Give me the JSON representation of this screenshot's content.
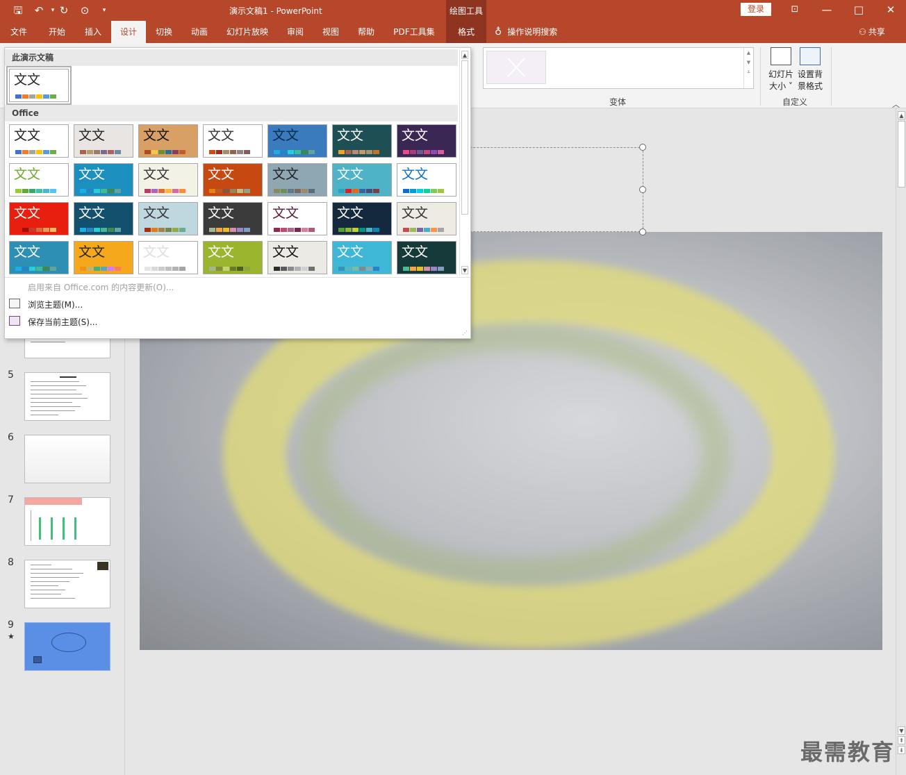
{
  "window": {
    "title": "演示文稿1  -  PowerPoint",
    "context_tab_group": "绘图工具",
    "login": "登录",
    "min": "—",
    "max": "□",
    "close": "✕"
  },
  "tabs": [
    {
      "label": "文件"
    },
    {
      "label": "开始"
    },
    {
      "label": "插入"
    },
    {
      "label": "设计"
    },
    {
      "label": "切换"
    },
    {
      "label": "动画"
    },
    {
      "label": "幻灯片放映"
    },
    {
      "label": "审阅"
    },
    {
      "label": "视图"
    },
    {
      "label": "帮助"
    },
    {
      "label": "PDF工具集"
    },
    {
      "label": "格式"
    }
  ],
  "search_label": "操作说明搜索",
  "share_label": "共享",
  "ribbon": {
    "variants_label": "变体",
    "customize_label": "自定义",
    "slide_size_line1": "幻灯片",
    "slide_size_line2": "大小 ˅",
    "format_bg_line1": "设置背",
    "format_bg_line2": "景格式"
  },
  "theme_gallery": {
    "this_presentation_label": "此演示文稿",
    "office_label": "Office",
    "thumb_text": "文文",
    "current_theme": {
      "swatches": [
        "#4472c4",
        "#ed7d31",
        "#a5a5a5",
        "#ffc000",
        "#5b9bd5",
        "#70ad47"
      ]
    },
    "themes": [
      {
        "bg": "#ffffff",
        "fg": "#222222",
        "sw": [
          "#4472c4",
          "#ed7d31",
          "#a5a5a5",
          "#ffc000",
          "#5b9bd5",
          "#70ad47"
        ]
      },
      {
        "bg": "#e9e5e3",
        "fg": "#222222",
        "sw": [
          "#a5644e",
          "#b39b6b",
          "#9e7b6b",
          "#7c6a8c",
          "#a86464",
          "#6b8c9e"
        ]
      },
      {
        "bg": "#d9a066",
        "fg": "#111111",
        "sw": [
          "#a94c1f",
          "#f3c54a",
          "#6a8e3c",
          "#2f6f8f",
          "#8b3a62",
          "#c35c2b"
        ]
      },
      {
        "bg": "#ffffff",
        "fg": "#333333",
        "sw": [
          "#d34817",
          "#9b2d1f",
          "#a28e6a",
          "#956251",
          "#918485",
          "#855d5d"
        ]
      },
      {
        "bg": "#3a7bbd",
        "fg": "#0a2a4a",
        "sw": [
          "#1cade4",
          "#2683c6",
          "#27ced7",
          "#42ba97",
          "#3e8853",
          "#62a39f"
        ]
      },
      {
        "bg": "#1e4f54",
        "fg": "#ffffff",
        "sw": [
          "#f0a22e",
          "#a5644e",
          "#b58b80",
          "#c3986d",
          "#a19574",
          "#c17529"
        ]
      },
      {
        "bg": "#3b2754",
        "fg": "#ffffff",
        "sw": [
          "#e84c8b",
          "#a63e7c",
          "#6b5b95",
          "#c34a7d",
          "#8a4fb3",
          "#d65ea0"
        ]
      },
      {
        "bg": "#ffffff",
        "fg": "#6da92c",
        "sw": [
          "#99cb38",
          "#63a537",
          "#37a76f",
          "#44c1a3",
          "#4eb3cf",
          "#51c3f9"
        ]
      },
      {
        "bg": "#1b8fbe",
        "fg": "#ffffff",
        "sw": [
          "#1cade4",
          "#2683c6",
          "#27ced7",
          "#42ba97",
          "#3e8853",
          "#62a39f"
        ]
      },
      {
        "bg": "#f2f2e6",
        "fg": "#333333",
        "sw": [
          "#b83d68",
          "#ac66bb",
          "#de6c36",
          "#f9b639",
          "#cf6da4",
          "#fa8d3d"
        ]
      },
      {
        "bg": "#c64912",
        "fg": "#ffffff",
        "sw": [
          "#e48312",
          "#bd582c",
          "#865640",
          "#9b8357",
          "#c2bc80",
          "#94a088"
        ]
      },
      {
        "bg": "#8ea7b3",
        "fg": "#222222",
        "sw": [
          "#8a8a5c",
          "#6b8e5a",
          "#5c7a8a",
          "#7a6a5a",
          "#9a8a6a",
          "#5a6a7a"
        ]
      },
      {
        "bg": "#4fb3c8",
        "fg": "#ffffff",
        "sw": [
          "#2da2bf",
          "#da1f28",
          "#eb641b",
          "#39639d",
          "#474b78",
          "#7d3c4a"
        ]
      },
      {
        "bg": "#ffffff",
        "fg": "#0f6fc6",
        "sw": [
          "#0f6fc6",
          "#009dd9",
          "#0bd0d9",
          "#10cf9b",
          "#7cca62",
          "#a5c249"
        ]
      },
      {
        "bg": "#e81f0f",
        "fg": "#ffffff",
        "sw": [
          "#e81f0f",
          "#a50e09",
          "#c83c2c",
          "#d86b44",
          "#e29b5a",
          "#ecb966"
        ]
      },
      {
        "bg": "#12506d",
        "fg": "#ffffff",
        "sw": [
          "#1cade4",
          "#2683c6",
          "#27ced7",
          "#42ba97",
          "#3e8853",
          "#62a39f"
        ]
      },
      {
        "bg": "#bfd8df",
        "fg": "#333333",
        "sw": [
          "#a53010",
          "#de7e18",
          "#9f8351",
          "#728653",
          "#92aa4c",
          "#6aac91"
        ]
      },
      {
        "bg": "#3b3b3b",
        "fg": "#ffffff",
        "sw": [
          "#a5b592",
          "#f3a447",
          "#e7bc29",
          "#d092a7",
          "#9c85c0",
          "#809ec2"
        ]
      },
      {
        "bg": "#ffffff",
        "fg": "#5a1b3b",
        "sw": [
          "#8c2d4e",
          "#c04b6e",
          "#a56b8c",
          "#6e2b4e",
          "#d4829c",
          "#b05a7a"
        ]
      },
      {
        "bg": "#14293d",
        "fg": "#ffffff",
        "sw": [
          "#549e39",
          "#8ab833",
          "#c0cf3a",
          "#029676",
          "#4ab5c4",
          "#0989b1"
        ]
      },
      {
        "bg": "#eeeae4",
        "fg": "#333333",
        "sw": [
          "#c0504d",
          "#9bbb59",
          "#8064a2",
          "#4bacc6",
          "#f79646",
          "#a5a5a5"
        ]
      },
      {
        "bg": "#2e8fb5",
        "fg": "#ffffff",
        "sw": [
          "#1cade4",
          "#2683c6",
          "#27ced7",
          "#42ba97",
          "#3e8853",
          "#62a39f"
        ]
      },
      {
        "bg": "#f5a81c",
        "fg": "#222222",
        "sw": [
          "#f09415",
          "#c1b56b",
          "#4baf73",
          "#5aa6c0",
          "#d17df9",
          "#fa7e5c"
        ]
      },
      {
        "bg": "#ffffff",
        "fg": "#dddddd",
        "sw": [
          "#e6e6e6",
          "#d9d9d9",
          "#cccccc",
          "#bfbfbf",
          "#b2b2b2",
          "#a5a5a5"
        ]
      },
      {
        "bg": "#9cb52f",
        "fg": "#ffffff",
        "sw": [
          "#a5b592",
          "#7f8f36",
          "#c2d46f",
          "#6a7a2a",
          "#4f5e1c",
          "#8ea83b"
        ]
      },
      {
        "bg": "#eceae4",
        "fg": "#111111",
        "sw": [
          "#2c2c2c",
          "#5a5a5a",
          "#8a8a8a",
          "#b0b0b0",
          "#d0d0d0",
          "#707070"
        ]
      },
      {
        "bg": "#3eb7d6",
        "fg": "#ffffff",
        "sw": [
          "#3494ba",
          "#58b6c0",
          "#75bda7",
          "#7a8c8e",
          "#84acb6",
          "#2683c6"
        ]
      },
      {
        "bg": "#163a3a",
        "fg": "#ffffff",
        "sw": [
          "#4cbd8e",
          "#f3a447",
          "#e7bc29",
          "#d092a7",
          "#9c85c0",
          "#809ec2"
        ]
      }
    ],
    "enable_updates": "启用来自 Office.com 的内容更新(O)...",
    "browse": "浏览主题(M)...",
    "save_current": "保存当前主题(S)..."
  },
  "slides": [
    {
      "num": "5",
      "kind": "text"
    },
    {
      "num": "6",
      "kind": "blank"
    },
    {
      "num": "7",
      "kind": "chart",
      "bars": [
        0.72,
        0.72,
        0.72,
        0.72
      ]
    },
    {
      "num": "8",
      "kind": "text-photo"
    },
    {
      "num": "9",
      "kind": "cloud",
      "marker": "★"
    }
  ],
  "watermark": "最需教育"
}
